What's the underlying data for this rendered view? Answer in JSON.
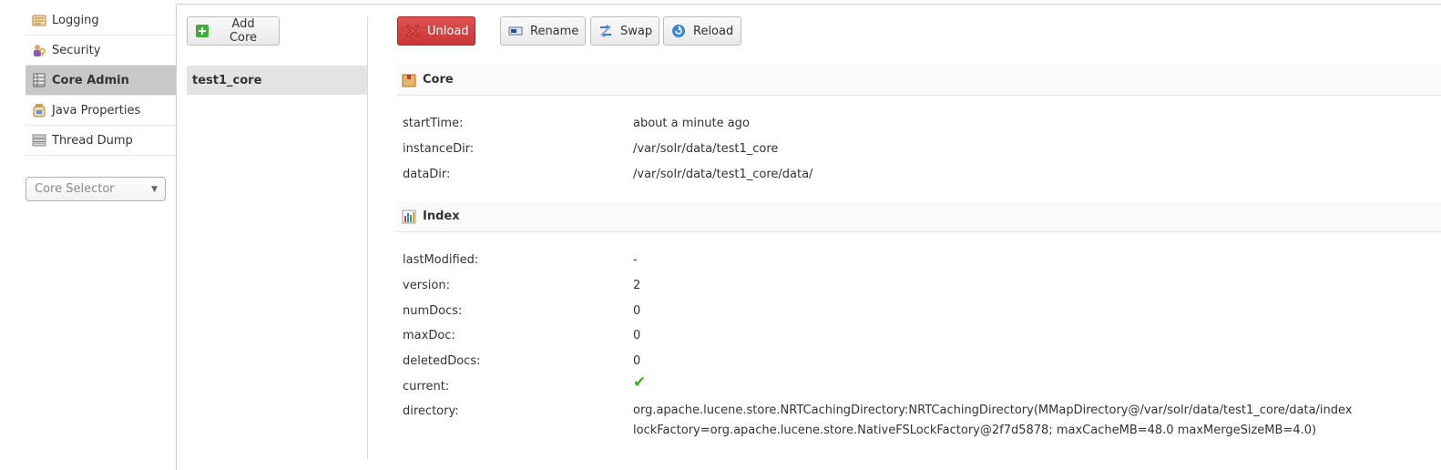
{
  "sidebar": {
    "items": [
      {
        "label": "Logging",
        "icon": "logging-icon",
        "active": false
      },
      {
        "label": "Security",
        "icon": "security-icon",
        "active": false
      },
      {
        "label": "Core Admin",
        "icon": "core-admin-icon",
        "active": true
      },
      {
        "label": "Java Properties",
        "icon": "java-properties-icon",
        "active": false
      },
      {
        "label": "Thread Dump",
        "icon": "thread-dump-icon",
        "active": false
      }
    ],
    "core_selector": {
      "placeholder": "Core Selector"
    }
  },
  "cores": {
    "add_label": "Add Core",
    "list": [
      "test1_core"
    ]
  },
  "toolbar": {
    "unload_label": "Unload",
    "rename_label": "Rename",
    "swap_label": "Swap",
    "reload_label": "Reload"
  },
  "core_section": {
    "title": "Core",
    "rows": [
      {
        "key": "startTime:",
        "value": "about a minute ago"
      },
      {
        "key": "instanceDir:",
        "value": "/var/solr/data/test1_core"
      },
      {
        "key": "dataDir:",
        "value": "/var/solr/data/test1_core/data/"
      }
    ]
  },
  "index_section": {
    "title": "Index",
    "rows": [
      {
        "key": "lastModified:",
        "value": "-"
      },
      {
        "key": "version:",
        "value": "2"
      },
      {
        "key": "numDocs:",
        "value": "0"
      },
      {
        "key": "maxDoc:",
        "value": "0"
      },
      {
        "key": "deletedDocs:",
        "value": "0"
      },
      {
        "key": "current:",
        "value": "✔"
      },
      {
        "key": "directory:",
        "value_lines": [
          "org.apache.lucene.store.NRTCachingDirectory:NRTCachingDirectory(MMapDirectory@/var/solr/data/test1_core/data/index",
          "lockFactory=org.apache.lucene.store.NativeFSLockFactory@2f7d5878; maxCacheMB=48.0 maxMergeSizeMB=4.0)"
        ]
      }
    ]
  },
  "colors": {
    "unload_bg": "#d23f3f",
    "active_nav_bg": "#c8c8c8",
    "check_green": "#3fae2a"
  }
}
